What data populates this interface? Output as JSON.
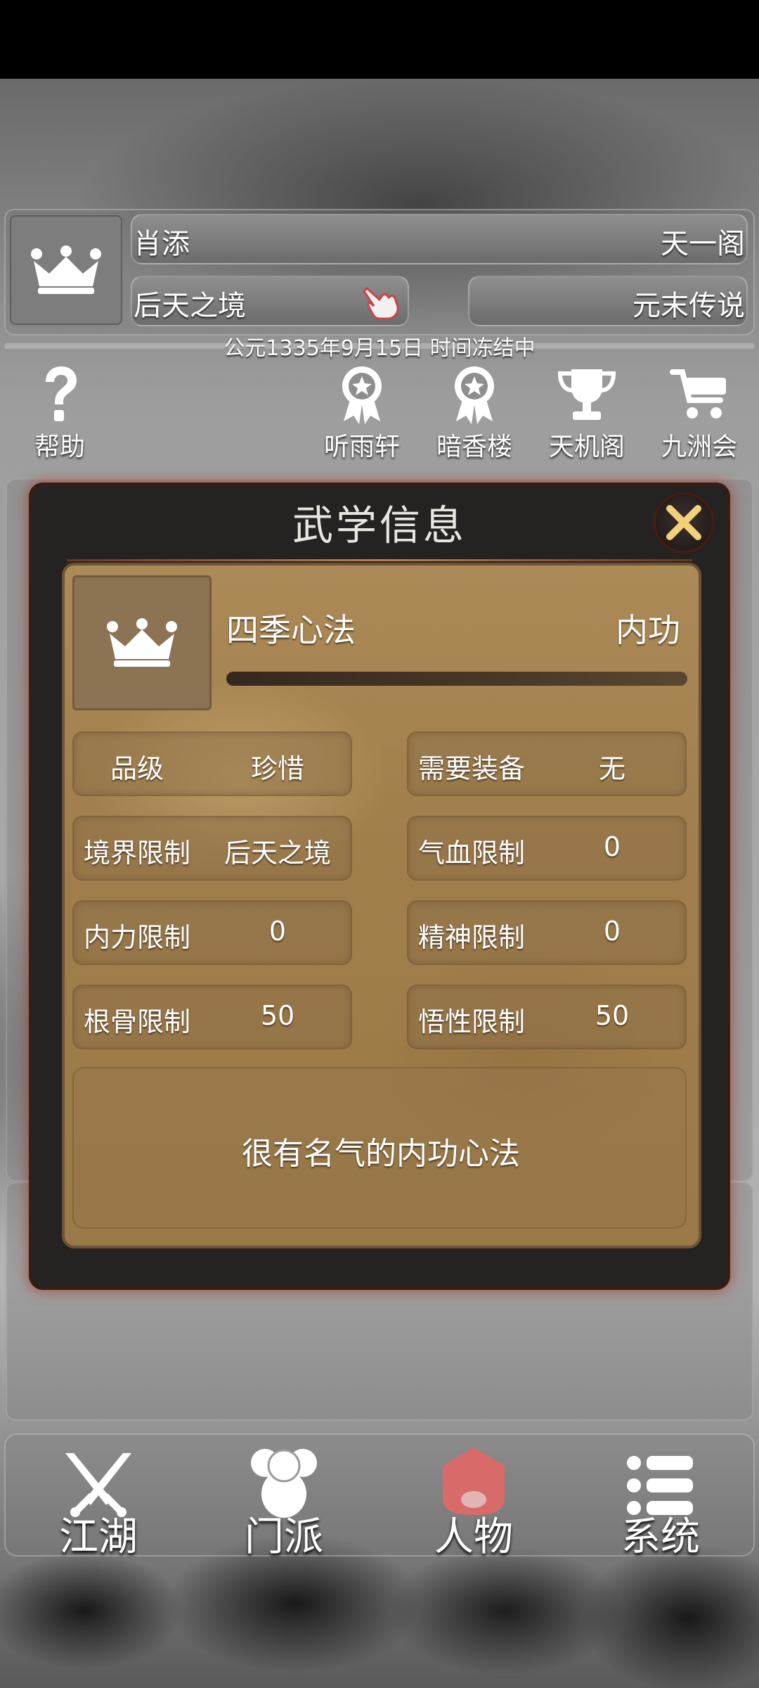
{
  "header": {
    "player_name": "肖添",
    "faction": "天一阁",
    "realm": "后天之境",
    "title": "元末传说",
    "date_line": "公元1335年9月15日 时间冻结中"
  },
  "top_nav": {
    "help": "帮助",
    "items": [
      "听雨轩",
      "暗香楼",
      "天机阁",
      "九洲会"
    ]
  },
  "dialog": {
    "title": "武学信息",
    "skill_name": "四季心法",
    "skill_type": "内功",
    "attributes": [
      {
        "key": "品级",
        "value": "珍惜"
      },
      {
        "key": "需要装备",
        "value": "无"
      },
      {
        "key": "境界限制",
        "value": "后天之境"
      },
      {
        "key": "气血限制",
        "value": "0"
      },
      {
        "key": "内力限制",
        "value": "0"
      },
      {
        "key": "精神限制",
        "value": "0"
      },
      {
        "key": "根骨限制",
        "value": "50"
      },
      {
        "key": "悟性限制",
        "value": "50"
      }
    ],
    "description": "很有名气的内功心法"
  },
  "bottom_tabs": [
    "江湖",
    "门派",
    "人物",
    "系统"
  ],
  "colors": {
    "parchment": "#a38150",
    "dialog_frame": "#252322",
    "close_icon": "#f1d27a",
    "active_tab_icon": "#d96a6a"
  }
}
